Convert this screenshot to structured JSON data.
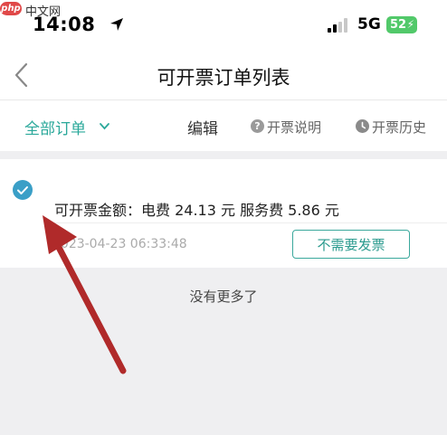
{
  "watermark": {
    "logo": "php",
    "text": "中文网"
  },
  "status_bar": {
    "time": "14:08",
    "network": "5G",
    "battery": "52"
  },
  "header": {
    "title": "可开票订单列表"
  },
  "toolbar": {
    "filter_label": "全部订单",
    "edit_label": "编辑",
    "help_label": "开票说明",
    "history_label": "开票历史"
  },
  "order": {
    "amount_text": "可开票金额：电费 24.13 元 服务费 5.86 元",
    "timestamp": "2023-04-23 06:33:48",
    "no_invoice_label": "不需要发票"
  },
  "list_footer": "没有更多了",
  "colors": {
    "accent": "#2aa89a",
    "annotation_arrow": "#b02a2a",
    "battery": "#52c96a"
  }
}
